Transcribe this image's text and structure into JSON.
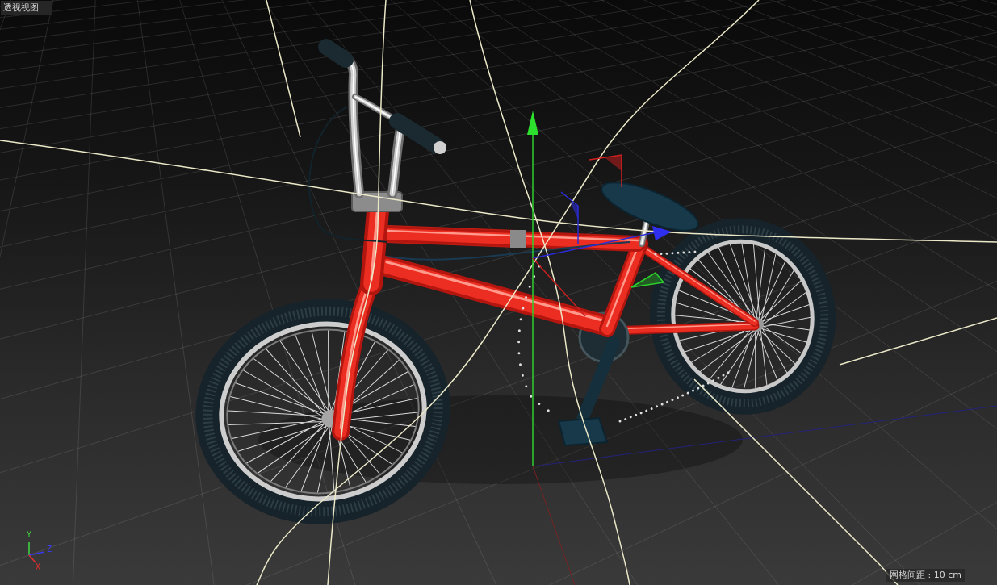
{
  "viewport": {
    "title": "透视视图"
  },
  "axis_indicator": {
    "labels": [
      {
        "kind": "y",
        "text": "Y"
      },
      {
        "kind": "z",
        "text": "Z"
      },
      {
        "kind": "x",
        "text": "X"
      }
    ]
  },
  "status": {
    "grid_spacing": "网格间距 : 10 cm"
  }
}
